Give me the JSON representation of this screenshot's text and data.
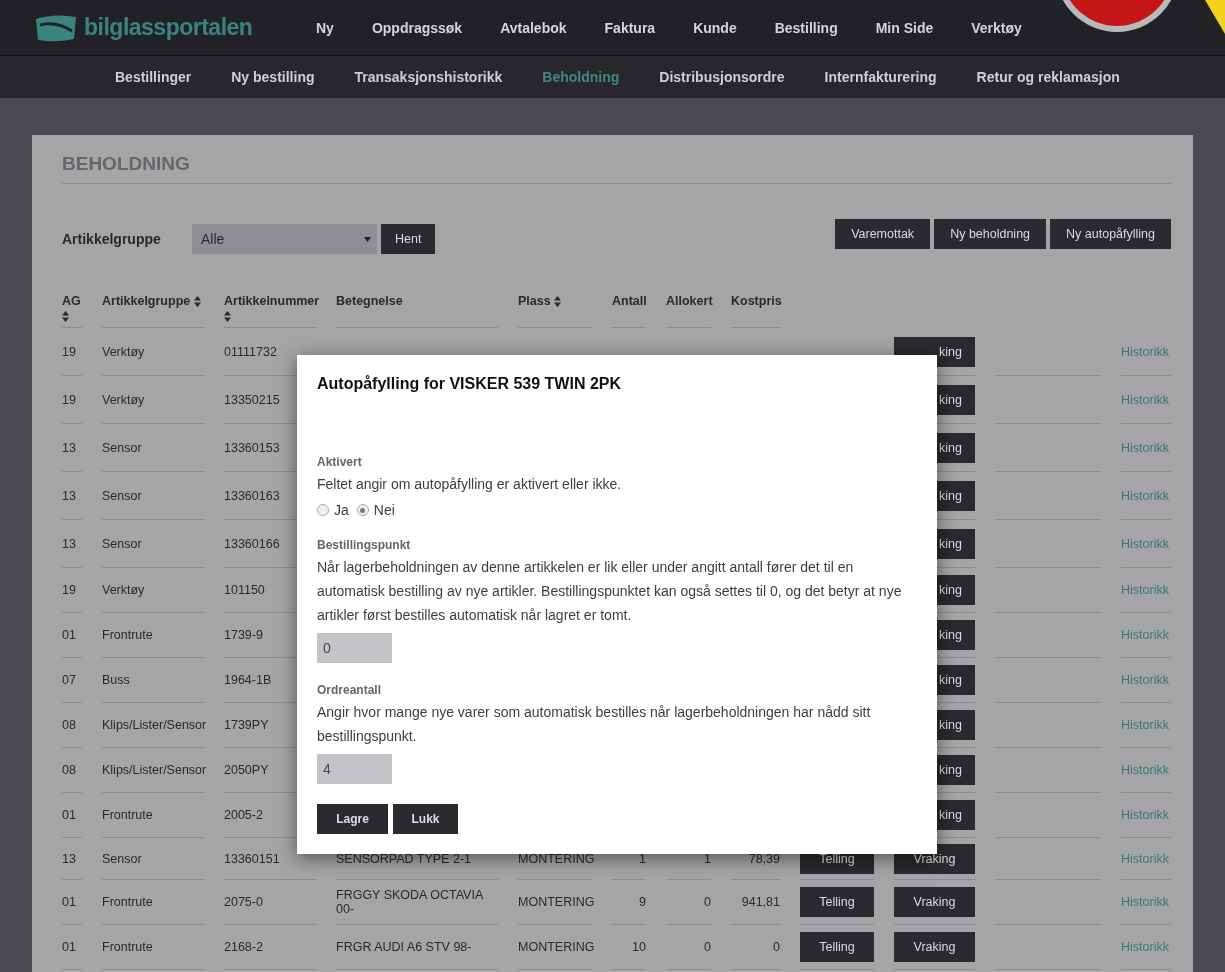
{
  "logo": {
    "text": "bilglassportalen"
  },
  "main_nav": [
    {
      "label": "Ny"
    },
    {
      "label": "Oppdragssøk"
    },
    {
      "label": "Avtalebok"
    },
    {
      "label": "Faktura"
    },
    {
      "label": "Kunde"
    },
    {
      "label": "Bestilling"
    },
    {
      "label": "Min Side"
    },
    {
      "label": "Verktøy"
    }
  ],
  "sub_nav": [
    {
      "label": "Bestillinger",
      "selected": false
    },
    {
      "label": "Ny bestilling",
      "selected": false
    },
    {
      "label": "Transaksjonshistorikk",
      "selected": false
    },
    {
      "label": "Beholdning",
      "selected": true
    },
    {
      "label": "Distribusjonsordre",
      "selected": false
    },
    {
      "label": "Internfakturering",
      "selected": false
    },
    {
      "label": "Retur og reklamasjon",
      "selected": false
    }
  ],
  "page_title": "BEHOLDNING",
  "filter": {
    "label": "Artikkelgruppe",
    "value": "Alle",
    "button": "Hent"
  },
  "actions": [
    "Varemottak",
    "Ny beholdning",
    "Ny autopåfylling"
  ],
  "table": {
    "columns": [
      {
        "label": "AG",
        "sortable": true
      },
      {
        "label": "Artikkelgruppe",
        "sortable": true
      },
      {
        "label": "Artikkelnummer",
        "sortable": true
      },
      {
        "label": "Betegnelse",
        "sortable": false
      },
      {
        "label": "Plass",
        "sortable": true
      },
      {
        "label": "Antall",
        "sortable": false
      },
      {
        "label": "Allokert",
        "sortable": false
      },
      {
        "label": "Kostpris",
        "sortable": false
      }
    ],
    "rows": [
      {
        "ag": "19",
        "group": "Verktøy",
        "number": "01111732",
        "scrap_button": "king",
        "covered": true,
        "link": "Historikk"
      },
      {
        "ag": "19",
        "group": "Verktøy",
        "number": "13350215",
        "scrap_button": "king",
        "covered": true,
        "link": "Historikk"
      },
      {
        "ag": "13",
        "group": "Sensor",
        "number": "13360153",
        "scrap_button": "king",
        "covered": true,
        "link": "Historikk"
      },
      {
        "ag": "13",
        "group": "Sensor",
        "number": "13360163",
        "scrap_button": "king",
        "covered": true,
        "link": "Historikk"
      },
      {
        "ag": "13",
        "group": "Sensor",
        "number": "13360166",
        "scrap_button": "king",
        "covered": true,
        "link": "Historikk"
      },
      {
        "ag": "19",
        "group": "Verktøy",
        "number": "101150",
        "scrap_button": "king",
        "covered": true,
        "link": "Historikk"
      },
      {
        "ag": "01",
        "group": "Frontrute",
        "number": "1739-9",
        "scrap_button": "king",
        "covered": true,
        "link": "Historikk"
      },
      {
        "ag": "07",
        "group": "Buss",
        "number": "1964-1B",
        "scrap_button": "king",
        "covered": true,
        "link": "Historikk"
      },
      {
        "ag": "08",
        "group": "Klips/Lister/Sensor",
        "number": "1739PY",
        "scrap_button": "king",
        "covered": true,
        "link": "Historikk"
      },
      {
        "ag": "08",
        "group": "Klips/Lister/Sensor",
        "number": "2050PY",
        "scrap_button": "king",
        "covered": true,
        "link": "Historikk"
      },
      {
        "ag": "01",
        "group": "Frontrute",
        "number": "2005-2",
        "scrap_button": "king",
        "covered": true,
        "link": "Historikk"
      },
      {
        "ag": "13",
        "group": "Sensor",
        "number": "13360151",
        "name": "SENSORPAD TYPE 2-1",
        "place": "MONTERING",
        "count": "1",
        "allocated": "1",
        "price": "78,39",
        "count_button": "Telling",
        "scrap_button": "Vraking",
        "covered": false,
        "link": "Historikk"
      },
      {
        "ag": "01",
        "group": "Frontrute",
        "number": "2075-0",
        "name": "FRGGY SKODA OCTAVIA 00-",
        "place": "MONTERING",
        "count": "9",
        "allocated": "0",
        "price": "941,81",
        "count_button": "Telling",
        "scrap_button": "Vraking",
        "covered": false,
        "link": "Historikk"
      },
      {
        "ag": "01",
        "group": "Frontrute",
        "number": "2168-2",
        "name": "FRGR AUDI A6 STV 98-",
        "place": "MONTERING",
        "count": "10",
        "allocated": "0",
        "price": "0",
        "count_button": "Telling",
        "scrap_button": "Vraking",
        "covered": false,
        "link": "Historikk"
      }
    ]
  },
  "dialog": {
    "title": "Autopåfylling for VISKER 539 TWIN 2PK",
    "sections": [
      {
        "kind": "radio",
        "label": "Aktivert",
        "help": "Feltet angir om autopåfylling er aktivert eller ikke.",
        "options": [
          {
            "label": "Ja",
            "selected": false
          },
          {
            "label": "Nei",
            "selected": true
          }
        ]
      },
      {
        "kind": "number",
        "label": "Bestillingspunkt",
        "help": "Når lagerbeholdningen av denne artikkelen er lik eller under angitt antall fører det til en automatisk bestilling av nye artikler. Bestillingspunktet kan også settes til 0, og det betyr at nye artikler først bestilles automatisk når lagret er tomt.",
        "value": "0"
      },
      {
        "kind": "number",
        "label": "Ordreantall",
        "help": "Angir hvor mange nye varer som automatisk bestilles når lagerbeholdningen har nådd sitt bestillingspunkt.",
        "value": "4"
      }
    ],
    "buttons": [
      "Lagre",
      "Lukk"
    ]
  }
}
